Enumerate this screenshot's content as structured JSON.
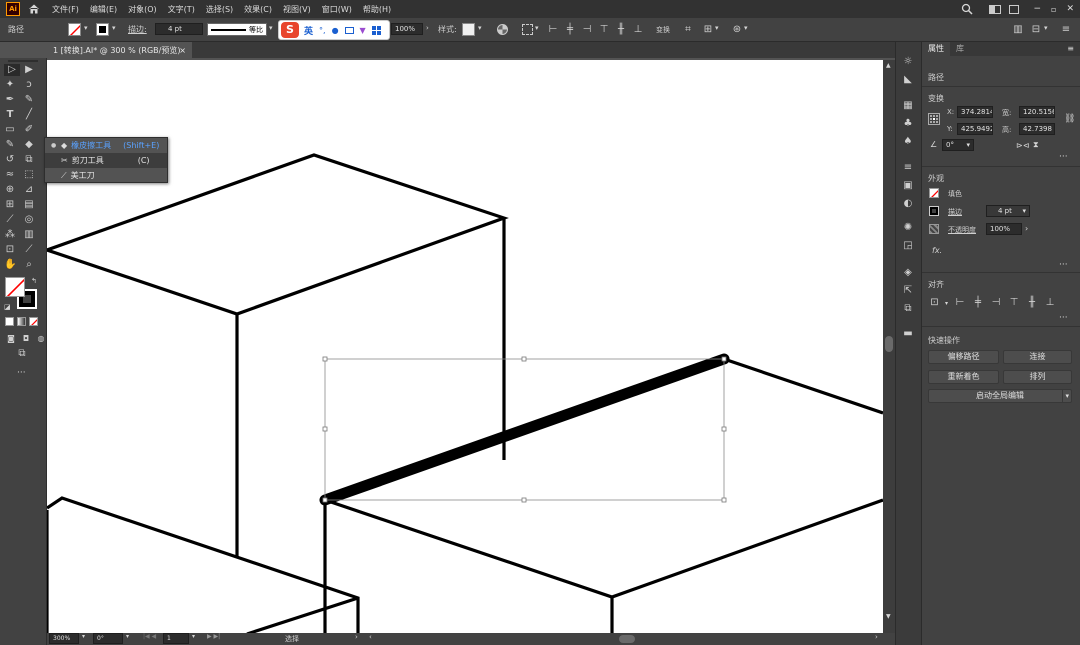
{
  "menubar": {
    "items": [
      "文件(F)",
      "编辑(E)",
      "对象(O)",
      "文字(T)",
      "选择(S)",
      "效果(C)",
      "视图(V)",
      "窗口(W)",
      "帮助(H)"
    ]
  },
  "controlbar": {
    "object_label": "路径",
    "stroke_label": "描边:",
    "stroke_value": "4 pt",
    "profile_label": "等比",
    "opacity_value": "100%",
    "style_label": "样式:",
    "transform_label": "变换"
  },
  "ime": {
    "label": "英"
  },
  "document": {
    "tab_title": "1 [转换].AI* @ 300 % (RGB/预览)"
  },
  "flyout": {
    "items": [
      {
        "label": "橡皮擦工具",
        "shortcut": "(Shift+E)"
      },
      {
        "label": "剪刀工具",
        "shortcut": "(C)"
      },
      {
        "label": "美工刀",
        "shortcut": ""
      }
    ]
  },
  "status": {
    "zoom": "300%",
    "rotation": "0°",
    "artboard": "1",
    "mode": "选择"
  },
  "panel": {
    "tabs": [
      "属性",
      "库"
    ],
    "selection_type": "路径",
    "transform": {
      "title": "变换",
      "x_label": "X:",
      "x": "374.2814",
      "y_label": "Y:",
      "y": "425.9492",
      "w_label": "宽:",
      "w": "120.5156",
      "h_label": "高:",
      "h": "42.7398",
      "angle": "0°"
    },
    "appearance": {
      "title": "外观",
      "fill_label": "填色",
      "stroke_label": "描边",
      "stroke_value": "4 pt",
      "opacity_label": "不透明度",
      "opacity_value": "100%",
      "fx": "fx."
    },
    "align": {
      "title": "对齐"
    },
    "quick_actions": {
      "title": "快速操作",
      "offset_path": "偏移路径",
      "join": "连接",
      "recolor": "重新着色",
      "arrange": "排列",
      "global_edit": "启动全局编辑"
    }
  },
  "icons": [
    "ai-logo-icon",
    "home-icon",
    "search-icon",
    "selection-tool-icon",
    "direct-selection-tool-icon",
    "pen-tool-icon",
    "type-tool-icon",
    "line-tool-icon",
    "rectangle-tool-icon",
    "paintbrush-tool-icon",
    "eraser-tool-icon",
    "rotate-tool-icon",
    "scale-tool-icon",
    "width-tool-icon",
    "free-transform-tool-icon",
    "shape-builder-tool-icon",
    "perspective-grid-tool-icon",
    "mesh-tool-icon",
    "gradient-tool-icon",
    "eyedropper-tool-icon",
    "blend-tool-icon",
    "symbol-sprayer-tool-icon",
    "column-graph-tool-icon",
    "artboard-tool-icon",
    "slice-tool-icon",
    "hand-tool-icon",
    "zoom-tool-icon",
    "fill-stroke-icon",
    "swap-icon",
    "default-colors-icon",
    "more-tools-icon",
    "scissors-icon",
    "knife-icon",
    "link-icon",
    "flip-horizontal-icon",
    "flip-vertical-icon"
  ],
  "colors": {
    "accent": "#ff0000",
    "ime_brand": "#e8452c"
  }
}
